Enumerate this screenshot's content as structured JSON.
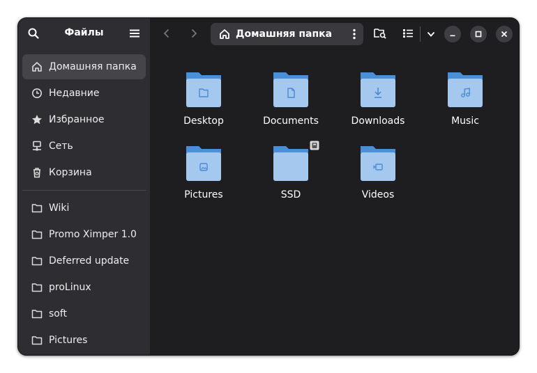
{
  "app": {
    "title": "Файлы"
  },
  "path": {
    "current": "Домашняя папка"
  },
  "sidebar": {
    "places": [
      {
        "label": "Домашняя папка",
        "icon": "home-icon",
        "active": true
      },
      {
        "label": "Недавние",
        "icon": "clock-icon"
      },
      {
        "label": "Избранное",
        "icon": "star-icon"
      },
      {
        "label": "Сеть",
        "icon": "network-icon"
      },
      {
        "label": "Корзина",
        "icon": "trash-icon"
      }
    ],
    "bookmarks": [
      {
        "label": "Wiki",
        "icon": "folder-icon"
      },
      {
        "label": "Promo Ximper 1.0",
        "icon": "folder-icon"
      },
      {
        "label": "Deferred update",
        "icon": "folder-icon"
      },
      {
        "label": "proLinux",
        "icon": "folder-icon"
      },
      {
        "label": "soft",
        "icon": "folder-icon"
      },
      {
        "label": "Pictures",
        "icon": "folder-icon"
      }
    ]
  },
  "files": [
    {
      "name": "Desktop",
      "emblem": "desktop-emblem-icon"
    },
    {
      "name": "Documents",
      "emblem": "document-emblem-icon"
    },
    {
      "name": "Downloads",
      "emblem": "download-emblem-icon"
    },
    {
      "name": "Music",
      "emblem": "music-emblem-icon"
    },
    {
      "name": "Pictures",
      "emblem": "picture-emblem-icon"
    },
    {
      "name": "SSD",
      "emblem": "",
      "badge": "drive-badge-icon"
    },
    {
      "name": "Videos",
      "emblem": "video-emblem-icon"
    }
  ],
  "colors": {
    "folder_front": "#a5c8ef",
    "folder_back": "#4a90d9",
    "emblem": "#4a8ad6",
    "accent": "#ffffff"
  }
}
